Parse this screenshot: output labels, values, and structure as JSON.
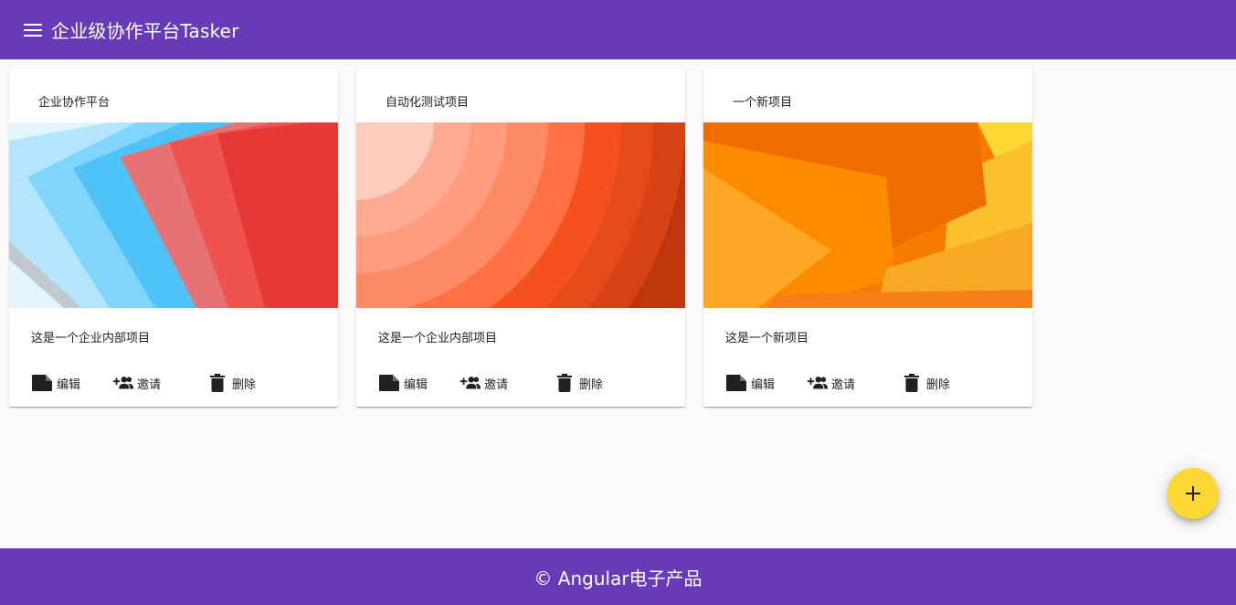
{
  "app": {
    "title": "企业级协作平台Tasker"
  },
  "projects": [
    {
      "name": "企业协作平台",
      "description": "这是一个企业内部项目",
      "cover": "blue-red-layers"
    },
    {
      "name": "自动化测试项目",
      "description": "这是一个企业内部项目",
      "cover": "coral-arcs"
    },
    {
      "name": "一个新项目",
      "description": "这是一个新项目",
      "cover": "orange-yellow-shapes"
    }
  ],
  "actions": {
    "edit": "编辑",
    "invite": "邀请",
    "delete": "删除"
  },
  "fab": {
    "icon": "add-icon"
  },
  "footer": {
    "text": "© Angular电子产品"
  },
  "colors": {
    "primary": "#673ab7",
    "accent": "#fdd835"
  }
}
